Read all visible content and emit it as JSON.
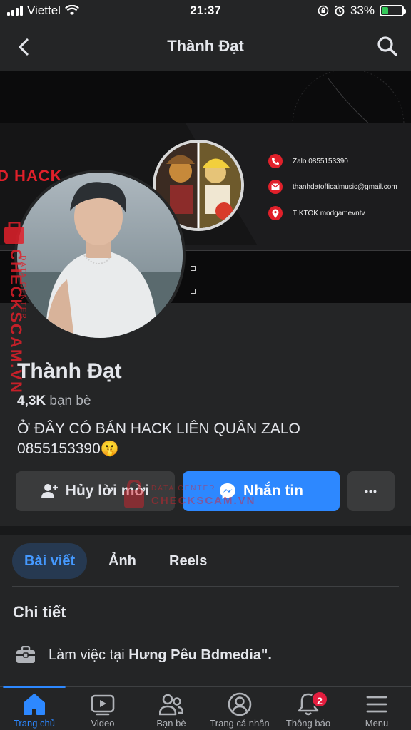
{
  "status_bar": {
    "carrier": "Viettel",
    "time": "21:37",
    "battery": "33%",
    "battery_level": 0.33
  },
  "header": {
    "title": "Thành Đạt"
  },
  "cover": {
    "banner_text": "D HACK",
    "contacts": [
      {
        "icon": "phone-icon",
        "text": "Zalo 0855153390"
      },
      {
        "icon": "mail-icon",
        "text": "thanhdatofficalmusic@gmail.com"
      },
      {
        "icon": "location-icon",
        "text": "TIKTOK modgamevntv"
      }
    ]
  },
  "watermark": {
    "brand": "CHECKSCAM.VN",
    "sub": "DATA CENTER"
  },
  "profile": {
    "name": "Thành Đạt",
    "friends_count": "4,3K",
    "friends_label": "bạn bè",
    "bio": "Ở ĐÂY CÓ BÁN HACK LIÊN QUÂN ZALO 0855153390🤫"
  },
  "actions": {
    "cancel_request": "Hủy lời mời",
    "message": "Nhắn tin",
    "more": "•••"
  },
  "tabs": [
    {
      "label": "Bài viết",
      "active": true
    },
    {
      "label": "Ảnh",
      "active": false
    },
    {
      "label": "Reels",
      "active": false
    }
  ],
  "details": {
    "title": "Chi tiết",
    "work_prefix": "Làm việc tại ",
    "work_place": "Hưng Pêu Bdmedia\"."
  },
  "bottom_nav": [
    {
      "label": "Trang chủ",
      "icon": "home-icon",
      "active": true
    },
    {
      "label": "Video",
      "icon": "video-icon",
      "active": false
    },
    {
      "label": "Bạn bè",
      "icon": "friends-icon",
      "active": false
    },
    {
      "label": "Trang cá nhân",
      "icon": "profile-icon",
      "active": false
    },
    {
      "label": "Thông báo",
      "icon": "bell-icon",
      "active": false,
      "badge": "2"
    },
    {
      "label": "Menu",
      "icon": "menu-icon",
      "active": false
    }
  ],
  "colors": {
    "background": "#242526",
    "accent": "#2d88ff",
    "badge": "#e41e3f",
    "watermark": "#e0202a"
  }
}
